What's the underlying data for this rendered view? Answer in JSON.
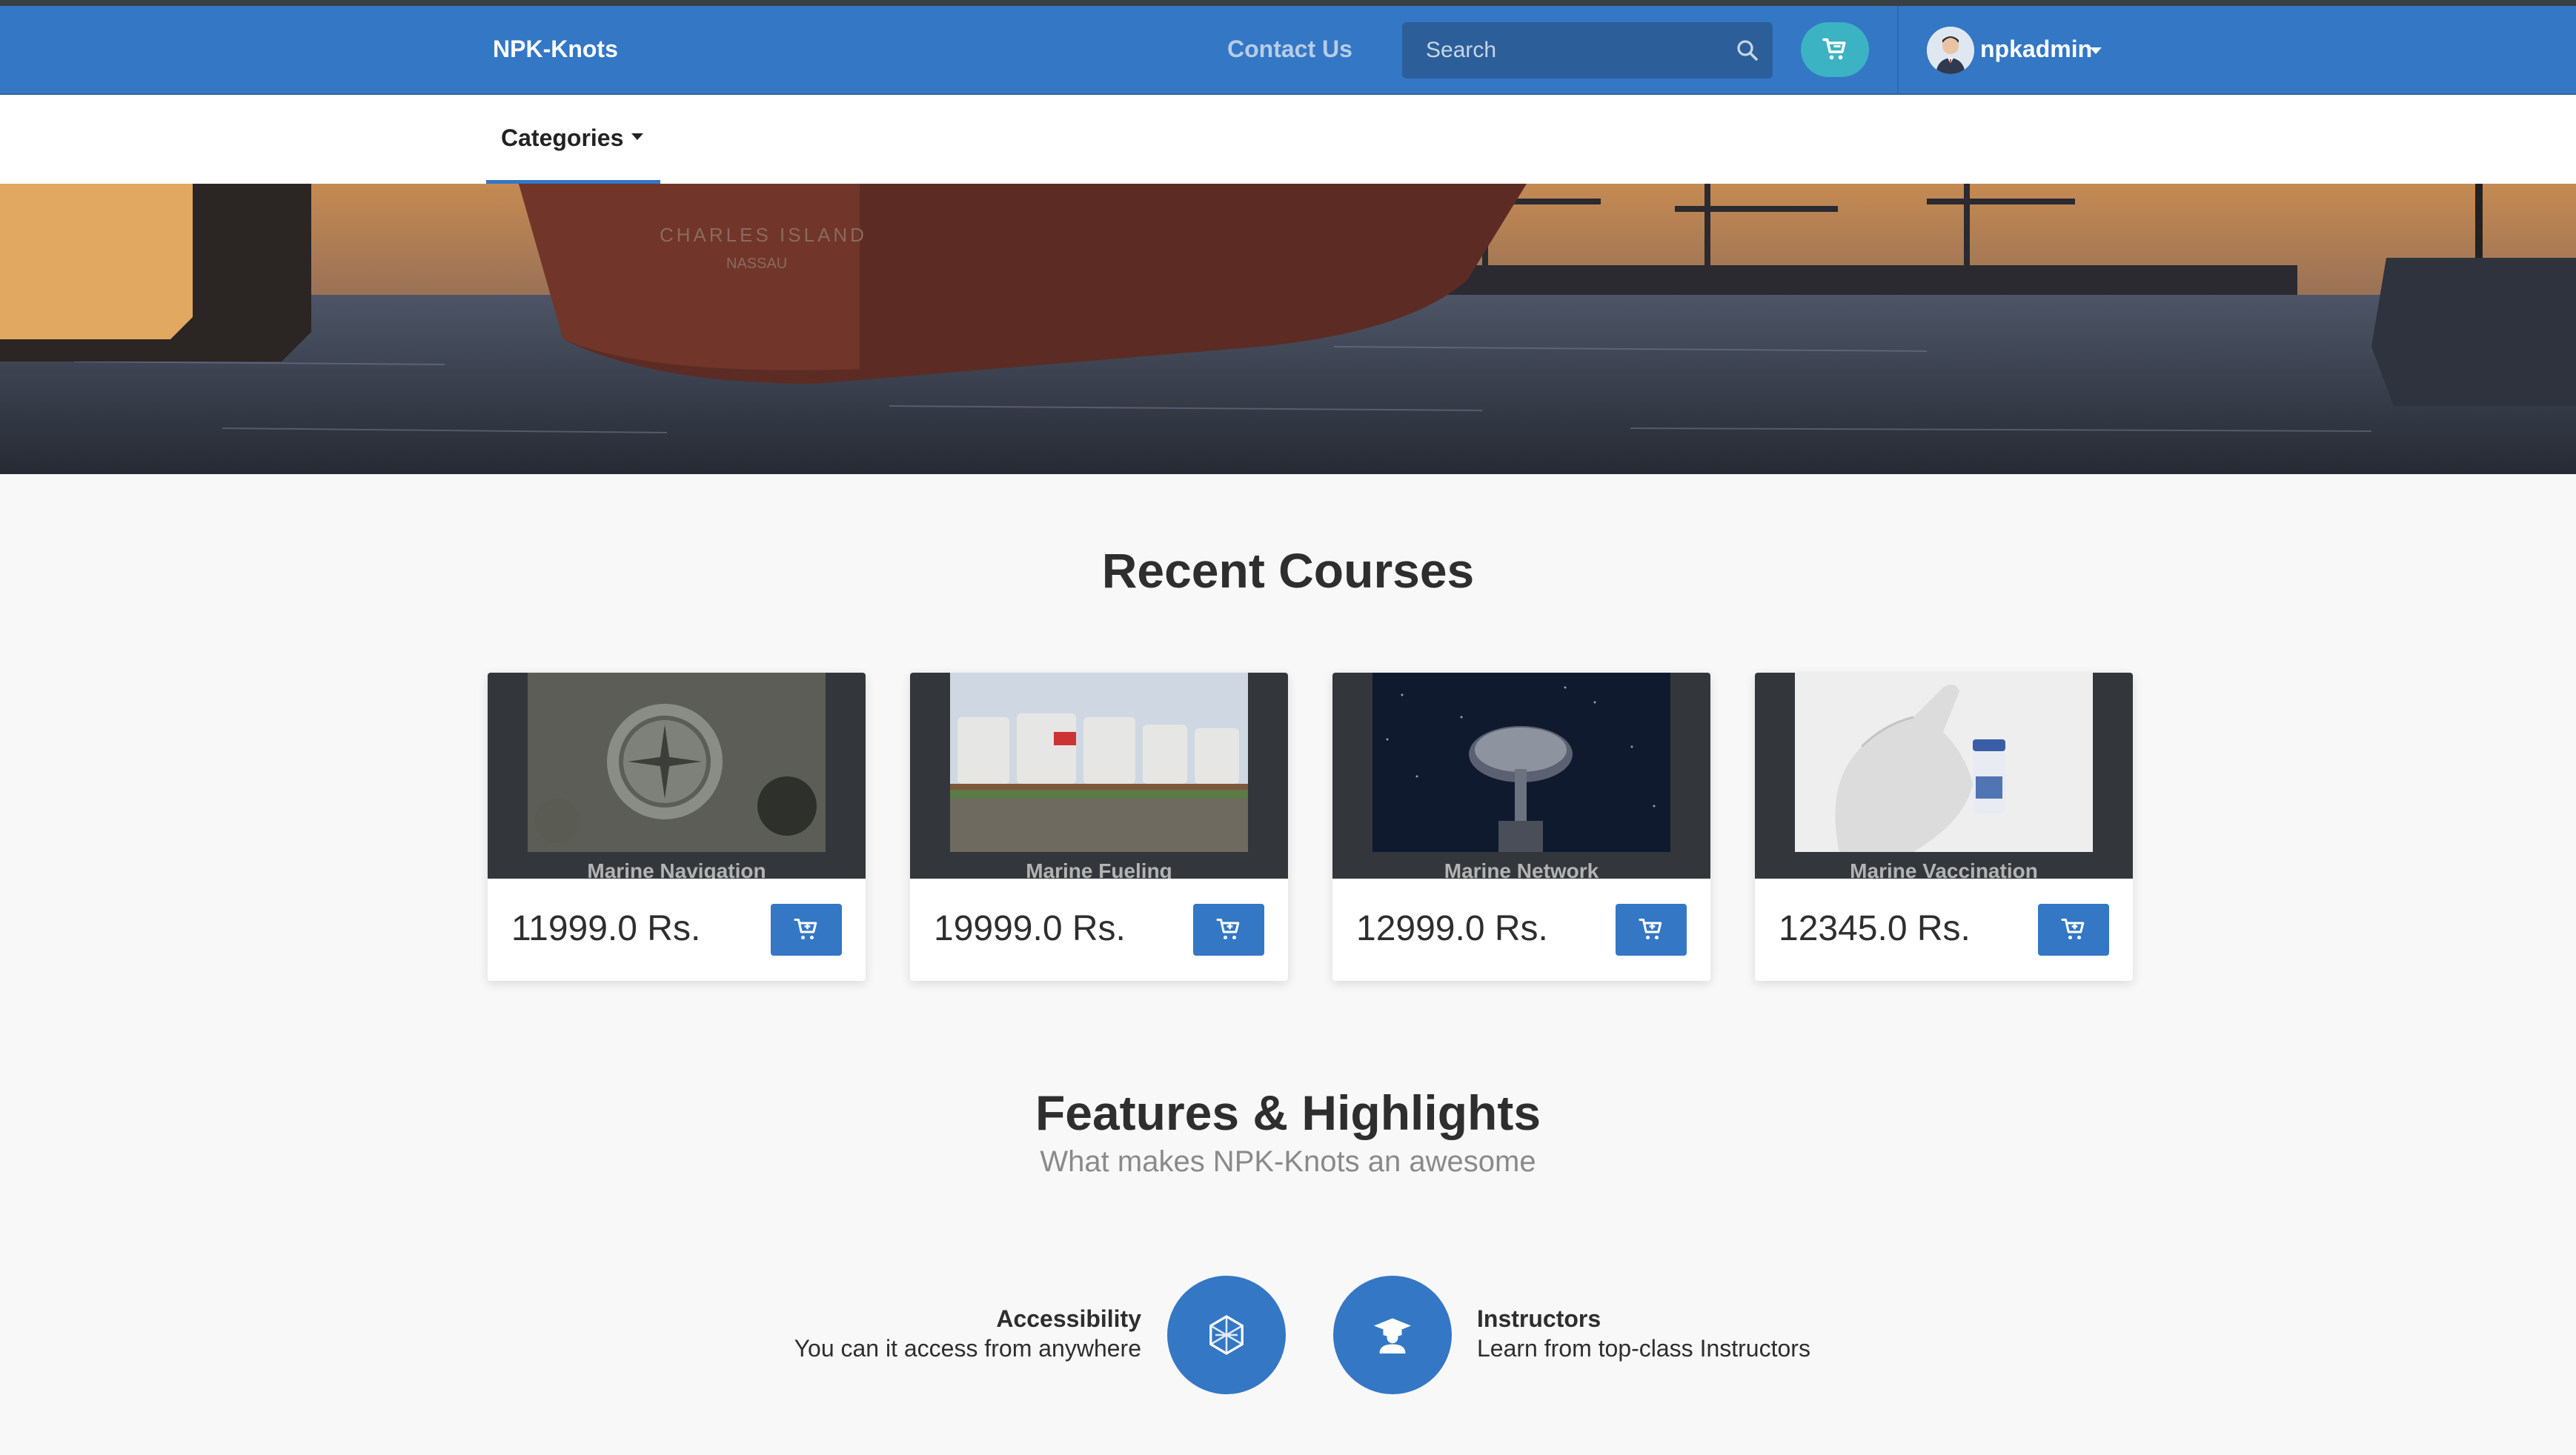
{
  "nav": {
    "brand": "NPK-Knots",
    "contact": "Contact Us",
    "search_placeholder": "Search",
    "username": "npkadmin"
  },
  "subnav": {
    "categories": "Categories"
  },
  "recent": {
    "heading": "Recent Courses",
    "courses": [
      {
        "title": "Marine Navigation",
        "price": "11999.0 Rs."
      },
      {
        "title": "Marine Fueling",
        "price": "19999.0 Rs."
      },
      {
        "title": "Marine Network",
        "price": "12999.0 Rs."
      },
      {
        "title": "Marine Vaccination",
        "price": "12345.0 Rs."
      }
    ]
  },
  "features": {
    "heading": "Features & Highlights",
    "subheading": "What makes NPK-Knots an awesome",
    "items": [
      {
        "title": "Accessibility",
        "desc": "You can it access from anywhere",
        "icon": "hexagon-globe-icon"
      },
      {
        "title": "Instructors",
        "desc": "Learn from top-class Instructors",
        "icon": "graduate-icon"
      }
    ]
  },
  "colors": {
    "primary": "#3477c5",
    "cart_button": "#3bb3c3",
    "card_header": "#33373c"
  }
}
